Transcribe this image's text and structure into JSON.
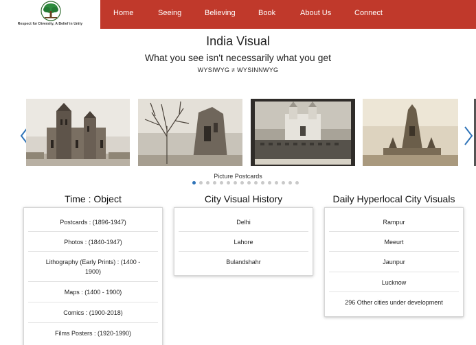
{
  "logo": {
    "tagline": "Respect for Diversity, A Belief in Unity"
  },
  "nav": {
    "items": [
      {
        "label": "Home"
      },
      {
        "label": "Seeing"
      },
      {
        "label": "Believing"
      },
      {
        "label": "Book"
      },
      {
        "label": "About Us"
      },
      {
        "label": "Connect"
      }
    ]
  },
  "hero": {
    "title": "India Visual",
    "subtitle": "What you see isn't necessarily what you get",
    "tagline": "WYSIWYG ≠ WYSINNWYG"
  },
  "carousel": {
    "caption": "Picture Postcards",
    "active_dot": 0,
    "dot_count": 16
  },
  "columns": [
    {
      "heading": "Time : Object",
      "items": [
        "Postcards : (1896-1947)",
        "Photos : (1840-1947)",
        "Lithography (Early Prints) : (1400 - 1900)",
        "Maps : (1400 - 1900)",
        "Comics : (1900-2018)",
        "Films Posters : (1920-1990)"
      ]
    },
    {
      "heading": "City Visual History",
      "items": [
        "Delhi",
        "Lahore",
        "Bulandshahr"
      ]
    },
    {
      "heading": "Daily Hyperlocal City Visuals",
      "items": [
        "Rampur",
        "Meeurt",
        "Jaunpur",
        "Lucknow",
        "296 Other cities under development"
      ]
    }
  ],
  "colors": {
    "nav_bg": "#c0392b",
    "accent": "#2e73b8"
  }
}
